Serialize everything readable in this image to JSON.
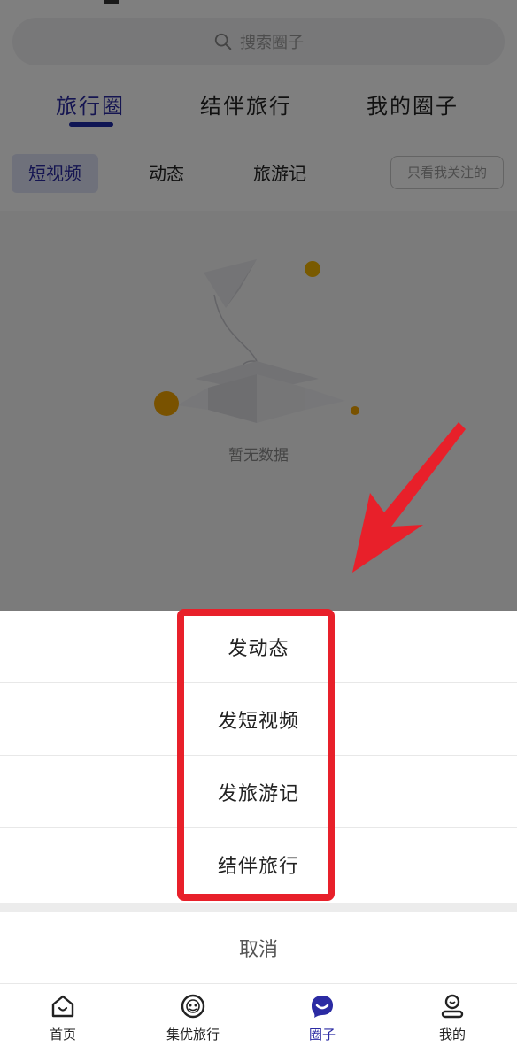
{
  "search": {
    "placeholder": "搜索圈子"
  },
  "main_tabs": [
    {
      "label": "旅行圈",
      "active": true
    },
    {
      "label": "结伴旅行",
      "active": false
    },
    {
      "label": "我的圈子",
      "active": false
    }
  ],
  "sub_tabs": [
    {
      "label": "短视频",
      "active": true
    },
    {
      "label": "动态",
      "active": false
    },
    {
      "label": "旅游记",
      "active": false
    }
  ],
  "follow_filter": {
    "label": "只看我关注的"
  },
  "empty_state": {
    "text": "暂无数据",
    "illustration": "paper-plane-box-icon"
  },
  "action_sheet": {
    "items": [
      {
        "label": "发动态"
      },
      {
        "label": "发短视频"
      },
      {
        "label": "发旅游记"
      },
      {
        "label": "结伴旅行"
      }
    ],
    "cancel": "取消"
  },
  "tabbar": {
    "items": [
      {
        "label": "首页",
        "icon": "home-icon",
        "active": false
      },
      {
        "label": "集优旅行",
        "icon": "face-icon",
        "active": false
      },
      {
        "label": "圈子",
        "icon": "chat-bubble-icon",
        "active": true
      },
      {
        "label": "我的",
        "icon": "person-icon",
        "active": false
      }
    ]
  },
  "colors": {
    "accent": "#2b2ba3",
    "annotation": "#e8202a",
    "overlay": "rgba(0,0,0,0.5)"
  }
}
